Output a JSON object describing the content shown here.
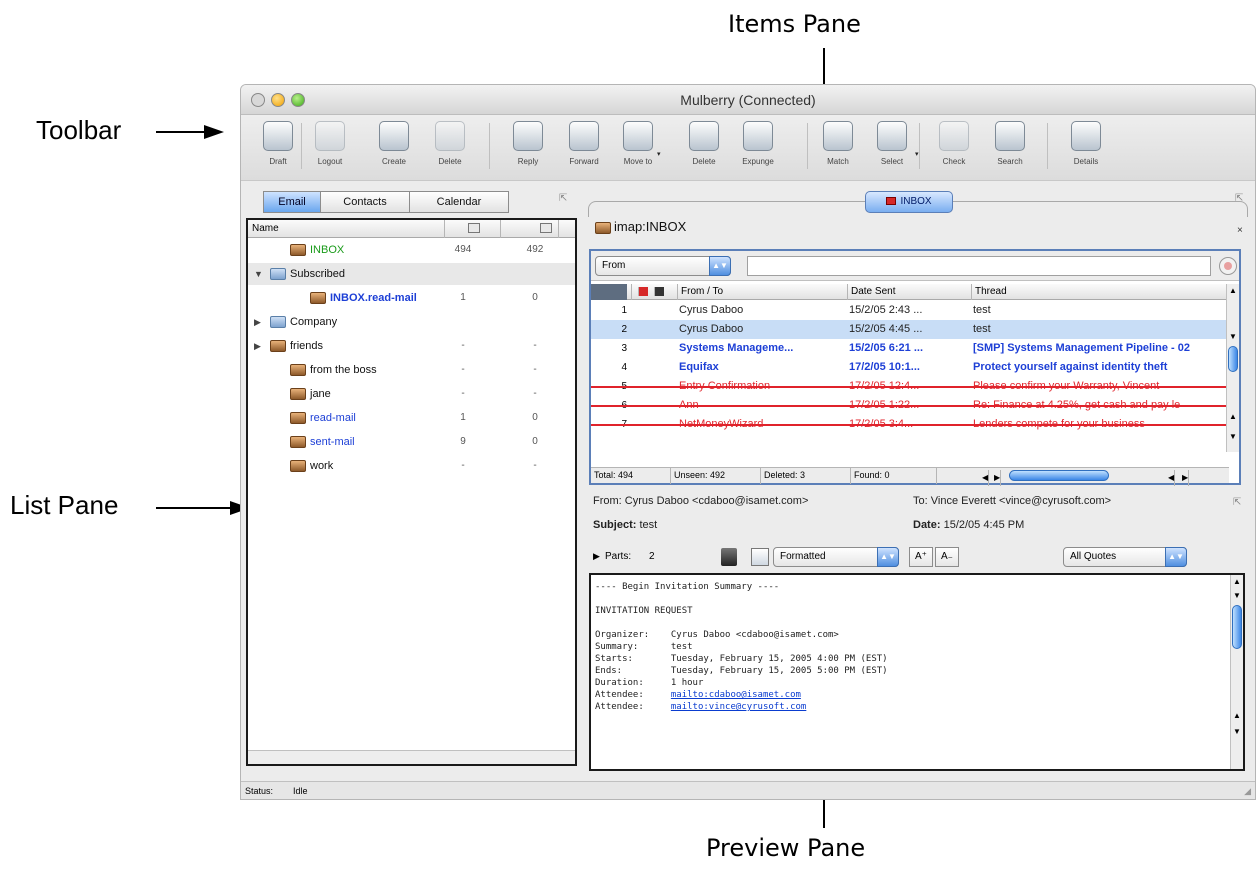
{
  "callouts": {
    "toolbar": "Toolbar",
    "list_pane": "List Pane",
    "items_pane": "Items Pane",
    "preview_pane": "Preview Pane"
  },
  "window": {
    "title": "Mulberry (Connected)"
  },
  "toolbar": {
    "buttons": [
      {
        "label": "Draft",
        "icon": "pencil-icon",
        "enabled": true
      },
      {
        "label": "Logout",
        "icon": "globe-icon",
        "enabled": false
      },
      {
        "label": "Create",
        "icon": "create-mailbox-icon",
        "enabled": true
      },
      {
        "label": "Delete",
        "icon": "delete-mailbox-icon",
        "enabled": false
      },
      {
        "label": "Reply",
        "icon": "reply-icon",
        "enabled": true
      },
      {
        "label": "Forward",
        "icon": "forward-icon",
        "enabled": true
      },
      {
        "label": "Move to",
        "icon": "move-to-icon",
        "enabled": true
      },
      {
        "label": "Delete",
        "icon": "trash-icon",
        "enabled": true
      },
      {
        "label": "Expunge",
        "icon": "expunge-icon",
        "enabled": true
      },
      {
        "label": "Match",
        "icon": "match-icon",
        "enabled": true
      },
      {
        "label": "Select",
        "icon": "select-icon",
        "enabled": true
      },
      {
        "label": "Check",
        "icon": "check-icon",
        "enabled": false
      },
      {
        "label": "Search",
        "icon": "search-icon",
        "enabled": true
      },
      {
        "label": "Details",
        "icon": "details-icon",
        "enabled": true
      }
    ]
  },
  "left_tabs": [
    "Email",
    "Contacts",
    "Calendar"
  ],
  "list_pane": {
    "columns": [
      "Name"
    ],
    "rows": [
      {
        "name": "INBOX",
        "c1": "494",
        "c2": "492",
        "color": "#1a9b1a",
        "bold": false,
        "indent": 1,
        "icon": "mailbox-icon"
      },
      {
        "name": "Subscribed",
        "c1": "",
        "c2": "",
        "color": "#111111",
        "bold": false,
        "indent": 0,
        "icon": "folder-icon",
        "triangle": "▼",
        "selected": true
      },
      {
        "name": "INBOX.read-mail",
        "c1": "1",
        "c2": "0",
        "color": "#1d3fd6",
        "bold": true,
        "indent": 2,
        "icon": "mailbox-icon"
      },
      {
        "name": "Company",
        "c1": "",
        "c2": "",
        "color": "#111111",
        "bold": false,
        "indent": 0,
        "icon": "folder-icon",
        "triangle": "▶"
      },
      {
        "name": "friends",
        "c1": "-",
        "c2": "-",
        "color": "#111111",
        "bold": false,
        "indent": 0,
        "icon": "mailbox-icon",
        "triangle": "▶"
      },
      {
        "name": "from the boss",
        "c1": "-",
        "c2": "-",
        "color": "#111111",
        "bold": false,
        "indent": 1,
        "icon": "mailbox-icon"
      },
      {
        "name": "jane",
        "c1": "-",
        "c2": "-",
        "color": "#111111",
        "bold": false,
        "indent": 1,
        "icon": "mailbox-icon"
      },
      {
        "name": "read-mail",
        "c1": "1",
        "c2": "0",
        "color": "#1d3fd6",
        "bold": false,
        "indent": 1,
        "icon": "mailbox-icon"
      },
      {
        "name": "sent-mail",
        "c1": "9",
        "c2": "0",
        "color": "#1d3fd6",
        "bold": false,
        "indent": 1,
        "icon": "mailbox-icon"
      },
      {
        "name": "work",
        "c1": "-",
        "c2": "-",
        "color": "#111111",
        "bold": false,
        "indent": 1,
        "icon": "mailbox-icon"
      }
    ]
  },
  "right_tab": "INBOX",
  "mailbox_path": "imap:INBOX",
  "items_pane": {
    "search_popup": "From",
    "columns": [
      "From / To",
      "Date Sent",
      "Thread"
    ],
    "rows": [
      {
        "num": "1",
        "from": "Cyrus Daboo",
        "date": "15/2/05 2:43 ...",
        "thread": "test",
        "color": "#222222",
        "bold": false,
        "selected": false,
        "strike": false
      },
      {
        "num": "2",
        "from": "Cyrus Daboo",
        "date": "15/2/05 4:45 ...",
        "thread": "test",
        "color": "#222222",
        "bold": false,
        "selected": true,
        "strike": false
      },
      {
        "num": "3",
        "from": "Systems Manageme...",
        "date": "15/2/05 6:21 ...",
        "thread": "[SMP] Systems Management Pipeline - 02",
        "color": "#1d3fd6",
        "bold": true,
        "selected": false,
        "strike": false
      },
      {
        "num": "4",
        "from": "Equifax",
        "date": "17/2/05 10:1...",
        "thread": "Protect yourself against identity theft",
        "color": "#1d3fd6",
        "bold": true,
        "selected": false,
        "strike": false
      },
      {
        "num": "5",
        "from": "Entry Confirmation",
        "date": "17/2/05 12:4...",
        "thread": "Please confirm your Warranty, Vincent",
        "color": "#e0232b",
        "bold": false,
        "selected": false,
        "strike": true
      },
      {
        "num": "6",
        "from": "Ann",
        "date": "17/2/05 1:22...",
        "thread": "Re: Finance at 4.25%, get cash and pay le",
        "color": "#e0232b",
        "bold": false,
        "selected": false,
        "strike": true
      },
      {
        "num": "7",
        "from": "NetMoneyWizard",
        "date": "17/2/05 3:4...",
        "thread": "Lenders compete for your business",
        "color": "#e0232b",
        "bold": false,
        "selected": false,
        "strike": true
      }
    ],
    "status": {
      "total": "Total: 494",
      "unseen": "Unseen: 492",
      "deleted": "Deleted: 3",
      "found": "Found: 0"
    }
  },
  "message_header": {
    "from_label": "From:",
    "from_value": "Cyrus Daboo <cdaboo@isamet.com>",
    "to_label": "To:",
    "to_value": "Vince Everett <vince@cyrusoft.com>",
    "subject_label": "Subject:",
    "subject_value": "test",
    "date_label": "Date:",
    "date_value": "15/2/05 4:45 PM"
  },
  "parts_bar": {
    "parts_label": "Parts:",
    "parts_count": "2",
    "format_popup": "Formatted",
    "font_up": "A⁺",
    "font_down": "A₋",
    "quotes_popup": "All Quotes"
  },
  "preview_lines": [
    {
      "text": "---- Begin Invitation Summary ----"
    },
    {
      "text": ""
    },
    {
      "text": "INVITATION REQUEST"
    },
    {
      "text": ""
    },
    {
      "text": "Organizer:    Cyrus Daboo <cdaboo@isamet.com>"
    },
    {
      "text": "Summary:      test"
    },
    {
      "text": "Starts:       Tuesday, February 15, 2005 4:00 PM (EST)"
    },
    {
      "text": "Ends:         Tuesday, February 15, 2005 5:00 PM (EST)"
    },
    {
      "text": "Duration:     1 hour"
    },
    {
      "text": "Attendee:     ",
      "link": "mailto:cdaboo@isamet.com"
    },
    {
      "text": "Attendee:     ",
      "link": "mailto:vince@cyrusoft.com"
    }
  ],
  "statusbar": {
    "label": "Status:",
    "value": "Idle"
  }
}
